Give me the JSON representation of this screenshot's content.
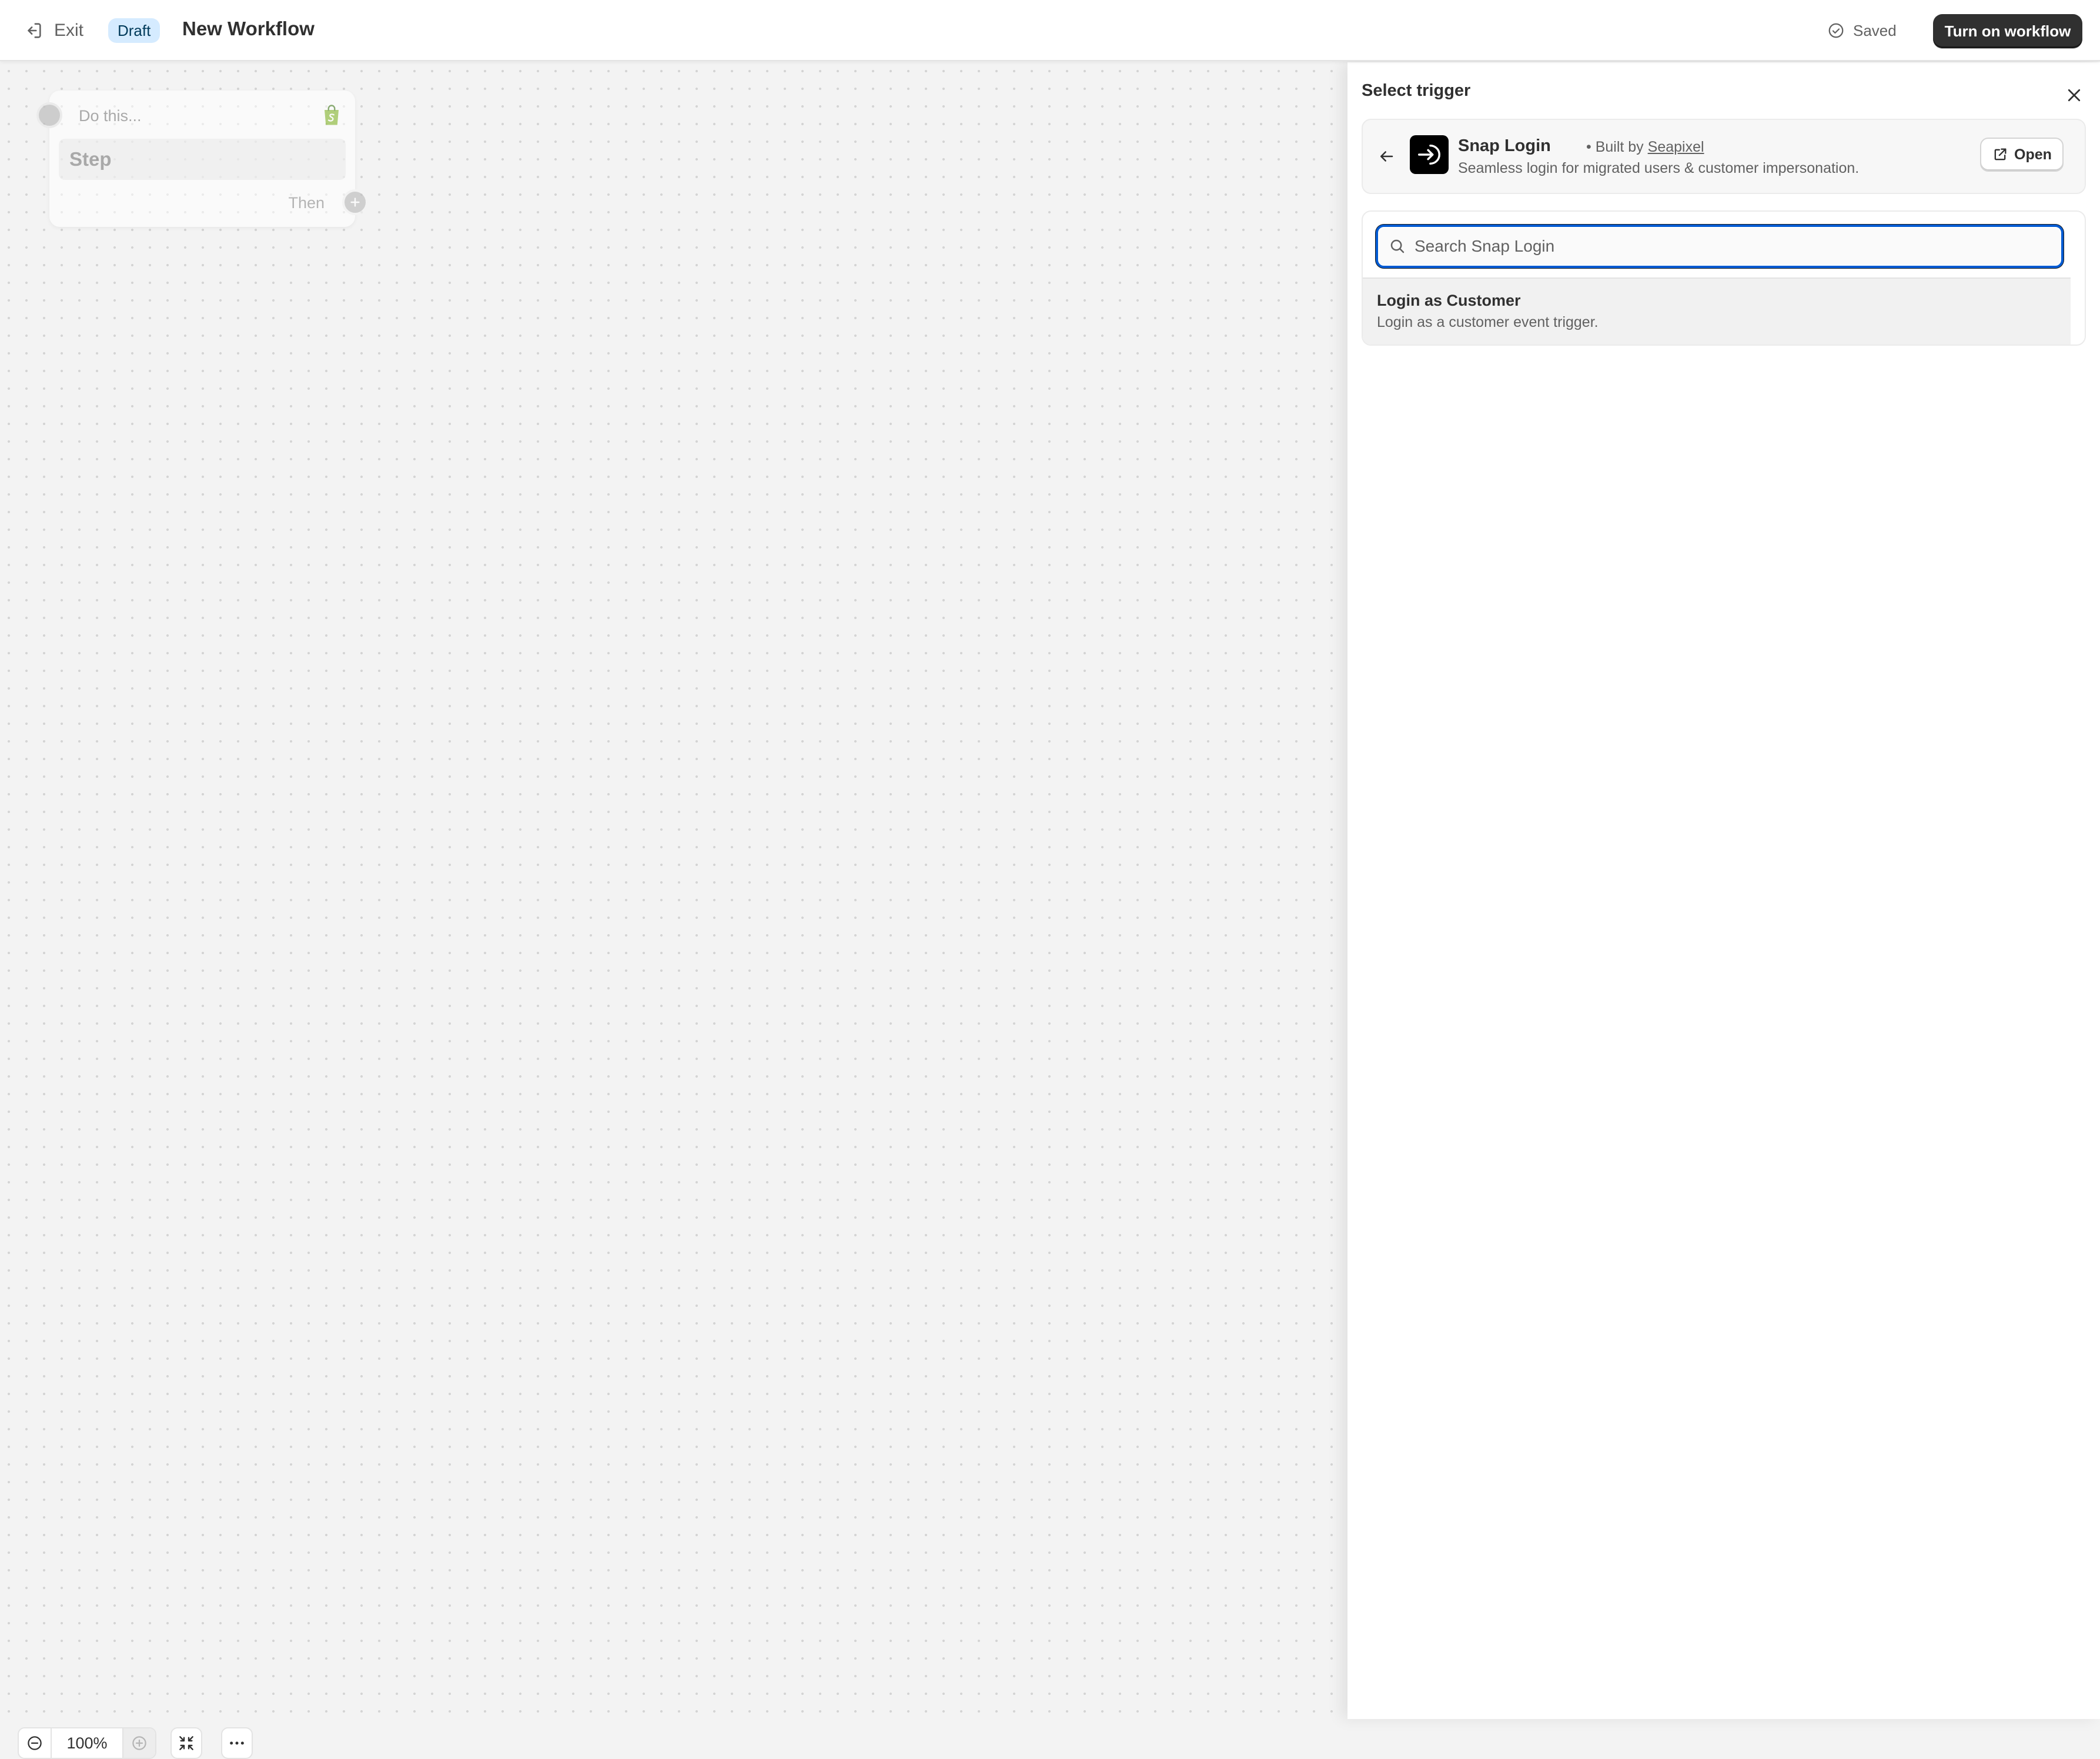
{
  "header": {
    "exit_label": "Exit",
    "status_badge": "Draft",
    "title": "New Workflow",
    "saved_label": "Saved",
    "turn_on_label": "Turn on workflow"
  },
  "canvas": {
    "node": {
      "label": "Do this...",
      "step_label": "Step",
      "then_label": "Then",
      "icon": "shopify-bag-icon"
    },
    "zoom": {
      "value": "100%"
    }
  },
  "panel": {
    "title": "Select trigger",
    "app": {
      "name": "Snap Login",
      "built_by_prefix": "• Built by",
      "built_by_name": "Seapixel",
      "description": "Seamless login for migrated users & customer impersonation.",
      "open_label": "Open"
    },
    "search": {
      "placeholder": "Search Snap Login",
      "value": ""
    },
    "results": [
      {
        "title": "Login as Customer",
        "description": "Login as a customer event trigger."
      }
    ]
  },
  "colors": {
    "primary_button": "#303030",
    "draft_badge_bg": "#d5ebff",
    "focus_ring": "#005bd3"
  }
}
